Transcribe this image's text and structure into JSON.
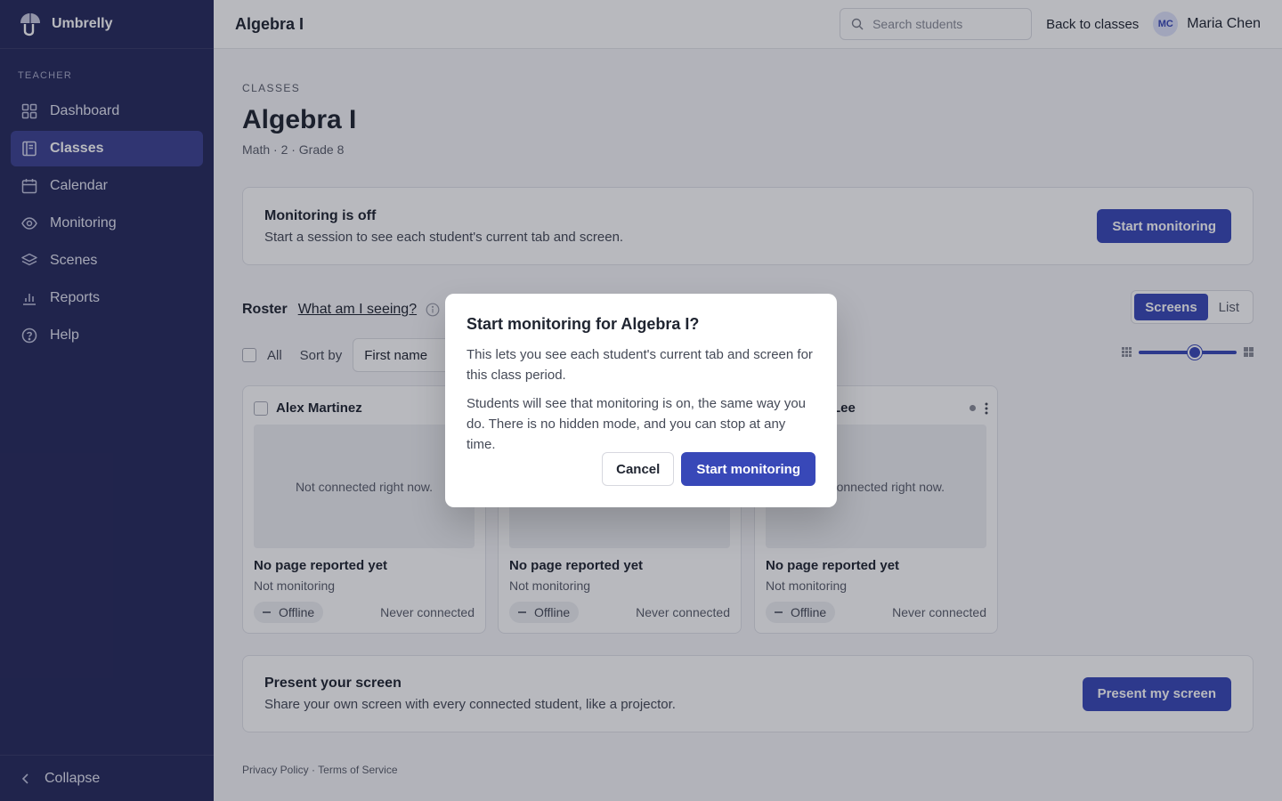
{
  "brand": {
    "name": "Umbrelly",
    "logo_icon": "umbrella-icon"
  },
  "sidebar": {
    "section_label": "TEACHER",
    "items": [
      {
        "label": "Dashboard",
        "icon": "grid-icon",
        "active": false
      },
      {
        "label": "Classes",
        "icon": "book-icon",
        "active": true
      },
      {
        "label": "Calendar",
        "icon": "calendar-icon",
        "active": false
      },
      {
        "label": "Monitoring",
        "icon": "eye-icon",
        "active": false
      },
      {
        "label": "Scenes",
        "icon": "layers-icon",
        "active": false
      },
      {
        "label": "Reports",
        "icon": "bar-chart-icon",
        "active": false
      },
      {
        "label": "Help",
        "icon": "help-circle-icon",
        "active": false
      }
    ],
    "collapse_label": "Collapse"
  },
  "topbar": {
    "title": "Algebra I",
    "search_placeholder": "Search students",
    "search_value": "",
    "back_label": "Back to classes",
    "user_initials": "MC",
    "user_name": "Maria Chen"
  },
  "page": {
    "eyebrow": "CLASSES",
    "title": "Algebra I",
    "subtitle": "Math · 2 · Grade 8"
  },
  "monitoring_card": {
    "title": "Monitoring is off",
    "description": "Start a session to see each student's current tab and screen.",
    "button_label": "Start monitoring"
  },
  "roster": {
    "label": "Roster",
    "help_link": "What am I seeing?",
    "view_options": [
      "Screens",
      "List"
    ],
    "selected_view": "Screens",
    "select_all_label": "All",
    "sort_label": "Sort by",
    "sort_value": "First name",
    "zoom_level": 0.5
  },
  "students": [
    {
      "name": "Alex Martinez",
      "screen_text": "Not connected right now.",
      "page": "No page reported yet",
      "monitoring": "Not monitoring",
      "status": "Offline",
      "connection": "Never connected"
    },
    {
      "name": "",
      "screen_text": "",
      "page": "No page reported yet",
      "monitoring": "Not monitoring",
      "status": "Offline",
      "connection": "Never connected"
    },
    {
      "name": "Lee",
      "screen_text": "Not connected right now.",
      "page": "No page reported yet",
      "monitoring": "Not monitoring",
      "status": "Offline",
      "connection": "Never connected"
    }
  ],
  "present_card": {
    "title": "Present your screen",
    "description": "Share your own screen with every connected student, like a projector.",
    "button_label": "Present my screen"
  },
  "footer": {
    "privacy": "Privacy Policy",
    "separator": "·",
    "terms": "Terms of Service"
  },
  "modal": {
    "title": "Start monitoring for Algebra I?",
    "paragraph1": "This lets you see each student's current tab and screen for this class period.",
    "paragraph2": "Students will see that monitoring is on, the same way you do. There is no hidden mode, and you can stop at any time.",
    "cancel_label": "Cancel",
    "confirm_label": "Start monitoring"
  },
  "colors": {
    "sidebar_bg": "#262a5c",
    "sidebar_active": "#3d4392",
    "accent": "#3848b8"
  }
}
